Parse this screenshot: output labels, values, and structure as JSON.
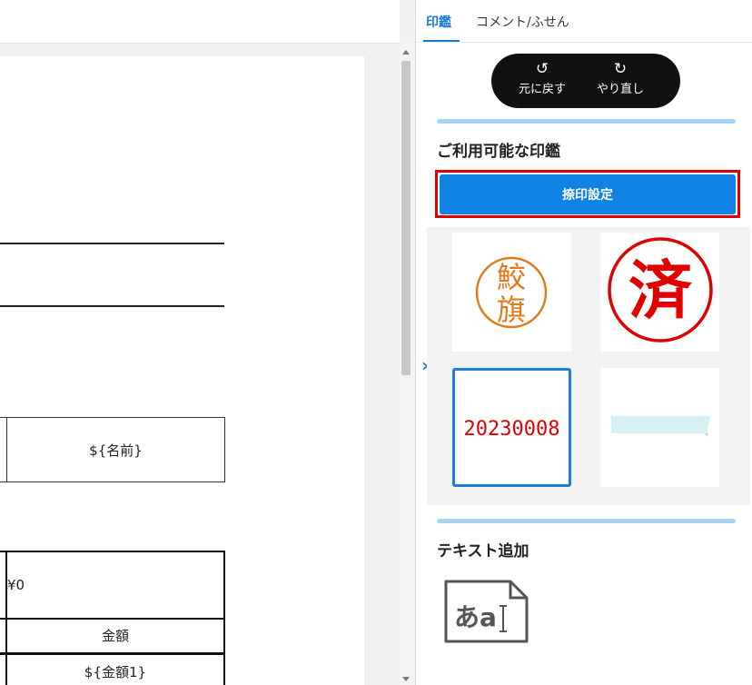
{
  "document": {
    "name_placeholder": "${名前}",
    "amount_value": "¥0",
    "amount_header": "金額",
    "amount_placeholder": "${金額1}"
  },
  "panel": {
    "tabs": [
      {
        "label": "印鑑",
        "active": true
      },
      {
        "label": "コメント/ふせん",
        "active": false
      }
    ],
    "undo_label": "元に戻す",
    "redo_label": "やり直し",
    "undo_icon": "undo-icon",
    "redo_icon": "redo-icon",
    "stamps_heading": "ご利用可能な印鑑",
    "stamp_settings_button": "捺印設定",
    "stamps": [
      {
        "type": "name-seal",
        "text_top": "鮫",
        "text_bottom": "旗",
        "color": "#e07a1c"
      },
      {
        "type": "done-seal",
        "text": "済",
        "color": "#e00000"
      },
      {
        "type": "date-stamp",
        "text": "20230008",
        "color": "#e00000",
        "selected": true
      },
      {
        "type": "sticky-note",
        "color": "#d7f0f3"
      }
    ],
    "text_heading": "テキスト追加",
    "text_add_icon_text": "あa"
  },
  "colors": {
    "accent": "#1082e3",
    "highlight": "#e00000",
    "divider": "#a8d4f0"
  }
}
